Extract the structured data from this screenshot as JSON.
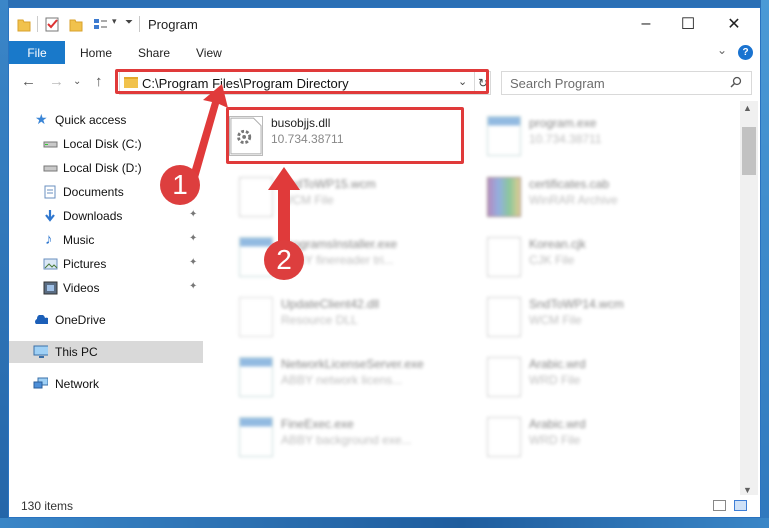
{
  "window": {
    "title": "Program",
    "controls": {
      "minimize": "–",
      "maximize": "☐",
      "close": "✕"
    }
  },
  "ribbon": {
    "file": "File",
    "tabs": [
      "Home",
      "Share",
      "View"
    ],
    "expand_glyph": "⌄",
    "help_glyph": "?"
  },
  "nav": {
    "back": "←",
    "forward": "→",
    "recent": "⌄",
    "up": "↑",
    "address": "C:\\Program Files\\Program Directory",
    "address_dropdown": "⌄",
    "refresh": "↻",
    "search_placeholder": "Search Program"
  },
  "sidebar": {
    "items": [
      {
        "label": "Quick access",
        "icon": "star-icon"
      },
      {
        "label": "Local Disk (C:)",
        "icon": "drive-icon"
      },
      {
        "label": "Local Disk (D:)",
        "icon": "drive-icon"
      },
      {
        "label": "Documents",
        "icon": "documents-icon"
      },
      {
        "label": "Downloads",
        "icon": "download-icon",
        "pinned": true
      },
      {
        "label": "Music",
        "icon": "music-icon",
        "pinned": true
      },
      {
        "label": "Pictures",
        "icon": "pictures-icon",
        "pinned": true
      },
      {
        "label": "Videos",
        "icon": "videos-icon",
        "pinned": true
      },
      {
        "label": "OneDrive",
        "icon": "cloud-icon"
      },
      {
        "label": "This PC",
        "icon": "pc-icon",
        "selected": true
      },
      {
        "label": "Network",
        "icon": "network-icon"
      }
    ],
    "pin_glyph": "📌"
  },
  "files": [
    {
      "name": "busobjjs.dll",
      "desc": "10.734.38711",
      "icon": "dll-gear-icon",
      "highlighted": true
    },
    {
      "name": "program.exe",
      "desc": "10.734.38711",
      "icon": "exe-icon"
    },
    {
      "name": "SndToWP15.wcm",
      "desc": "WCM File",
      "icon": "document-icon"
    },
    {
      "name": "certificates.cab",
      "desc": "WinRAR Archive",
      "icon": "winrar-icon"
    },
    {
      "name": "ProgramsInstaller.exe",
      "desc": "ABBY finereader tri...",
      "icon": "exe-icon"
    },
    {
      "name": "Korean.cjk",
      "desc": "CJK File",
      "icon": "document-icon"
    },
    {
      "name": "UpdateClient42.dll",
      "desc": "Resource DLL",
      "icon": "dll-gear-icon"
    },
    {
      "name": "SndToWP14.wcm",
      "desc": "WCM File",
      "icon": "document-icon"
    },
    {
      "name": "NetworkLicenseServer.exe",
      "desc": "ABBY network licens...",
      "icon": "exe-icon"
    },
    {
      "name": "Arabic.wrd",
      "desc": "WRD File",
      "icon": "document-icon"
    },
    {
      "name": "FineExec.exe",
      "desc": "ABBY background exe...",
      "icon": "exe-icon"
    },
    {
      "name": "Arabic.wrd",
      "desc": "WRD File",
      "icon": "document-icon"
    }
  ],
  "status": {
    "item_count": "130 items"
  },
  "annotations": {
    "step1": "1",
    "step2": "2",
    "color": "#e03a3a"
  },
  "colors": {
    "accent": "#1979ca",
    "selected": "#d9d9d9"
  }
}
